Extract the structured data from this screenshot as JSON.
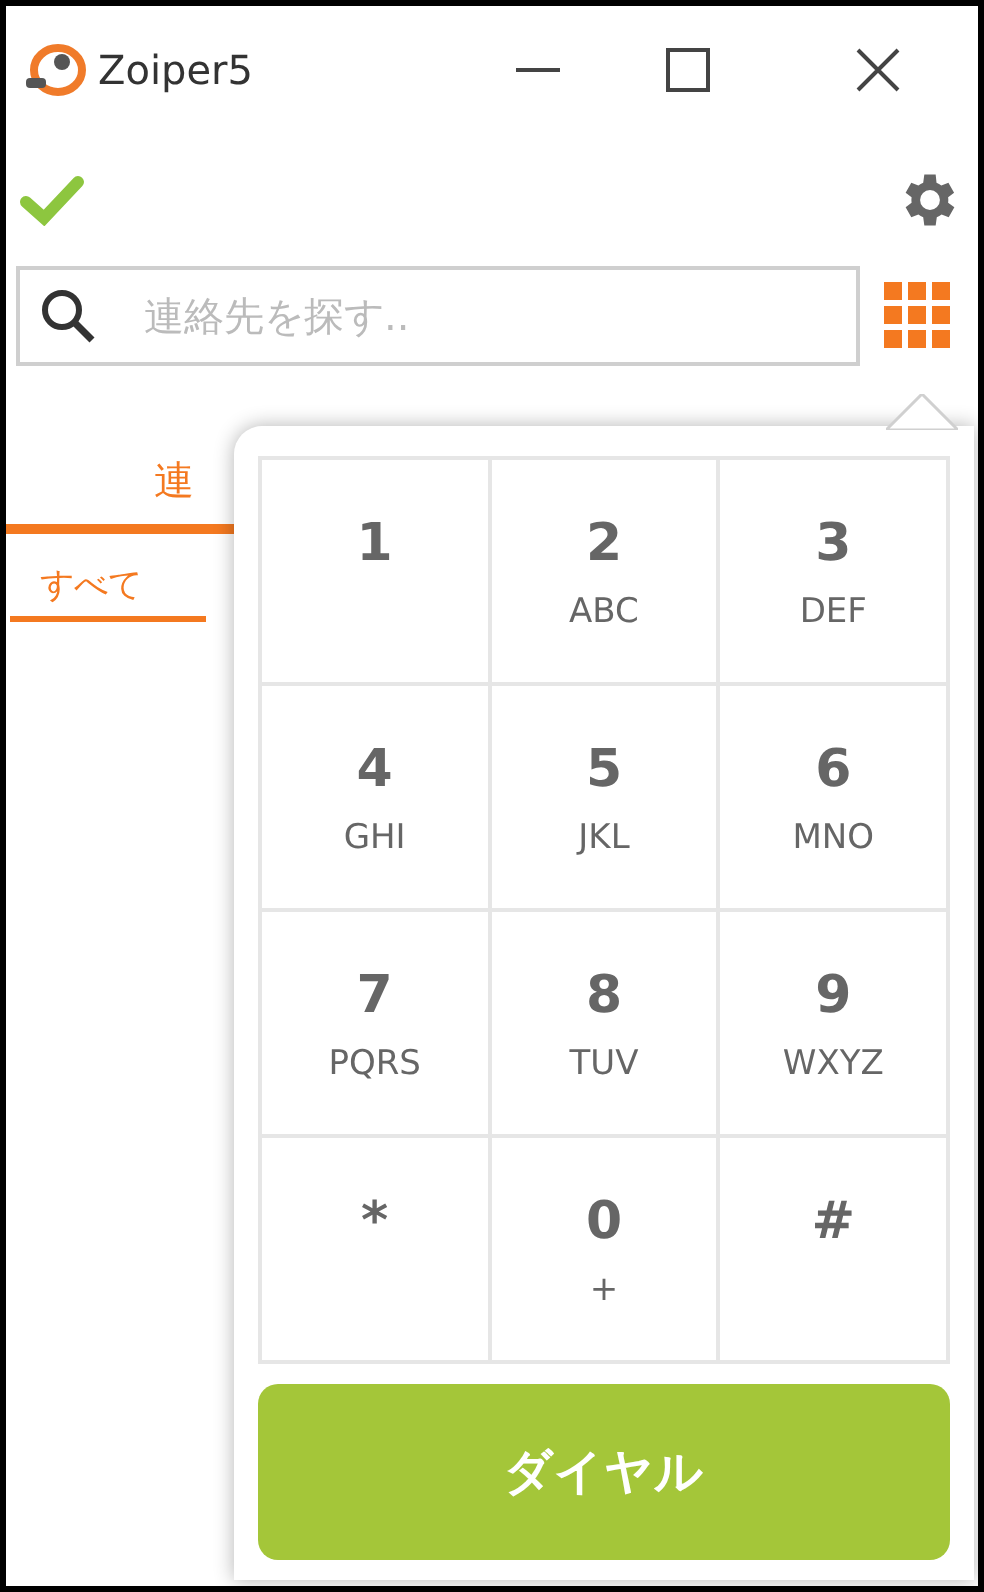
{
  "window": {
    "title": "Zoiper5"
  },
  "status": {
    "registered": true
  },
  "search": {
    "placeholder": "連絡先を探す.."
  },
  "tabs": [
    {
      "label": "連",
      "selected": true
    }
  ],
  "subtabs": [
    {
      "label": "すべて",
      "selected": true
    }
  ],
  "dialpad": {
    "keys": [
      {
        "digit": "1"
      },
      {
        "digit": "2",
        "letters": "ABC"
      },
      {
        "digit": "3",
        "letters": "DEF"
      },
      {
        "digit": "4",
        "letters": "GHI"
      },
      {
        "digit": "5",
        "letters": "JKL"
      },
      {
        "digit": "6",
        "letters": "MNO"
      },
      {
        "digit": "7",
        "letters": "PQRS"
      },
      {
        "digit": "8",
        "letters": "TUV"
      },
      {
        "digit": "9",
        "letters": "WXYZ"
      },
      {
        "digit": "*"
      },
      {
        "digit": "0",
        "letters": "+"
      },
      {
        "digit": "#"
      }
    ],
    "dial_button": "ダイヤル"
  }
}
